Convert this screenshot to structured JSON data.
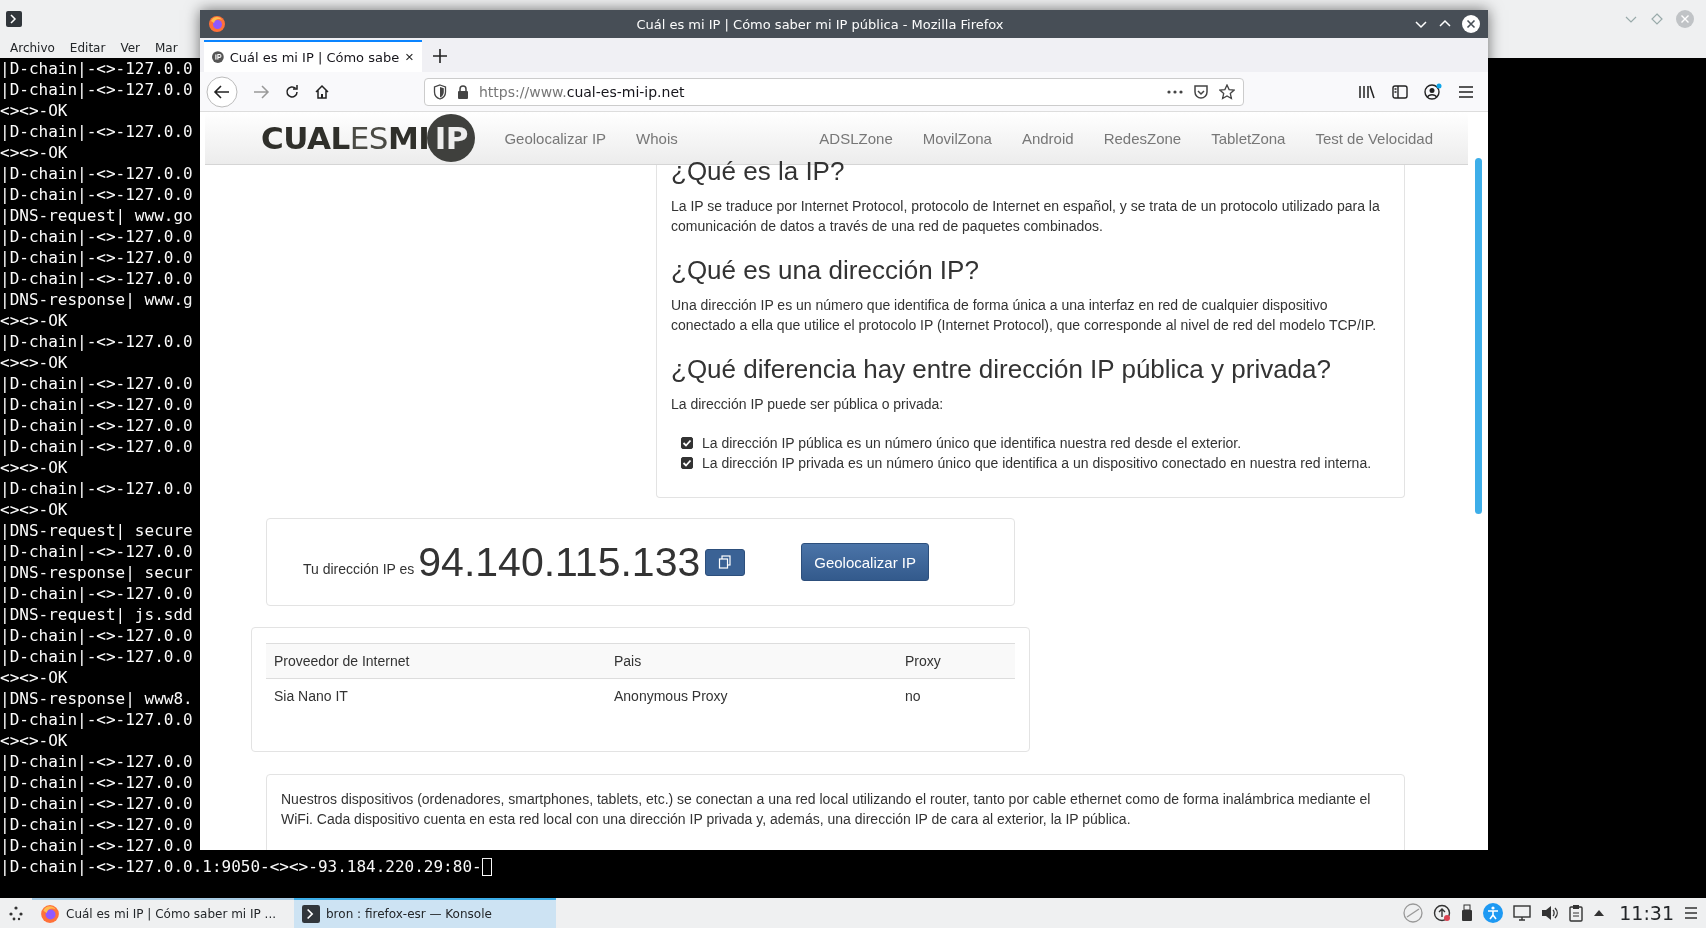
{
  "konsole": {
    "menu": [
      "Archivo",
      "Editar",
      "Ver",
      "Mar"
    ],
    "lines": [
      "|D-chain|-<>-127.0.0",
      "|D-chain|-<>-127.0.0",
      "<><>-OK",
      "|D-chain|-<>-127.0.0",
      "<><>-OK",
      "|D-chain|-<>-127.0.0",
      "|D-chain|-<>-127.0.0",
      "|DNS-request| www.go",
      "|D-chain|-<>-127.0.0",
      "|D-chain|-<>-127.0.0",
      "|D-chain|-<>-127.0.0",
      "|DNS-response| www.g",
      "<><>-OK",
      "|D-chain|-<>-127.0.0",
      "<><>-OK",
      "|D-chain|-<>-127.0.0",
      "|D-chain|-<>-127.0.0",
      "|D-chain|-<>-127.0.0",
      "|D-chain|-<>-127.0.0",
      "<><>-OK",
      "|D-chain|-<>-127.0.0",
      "<><>-OK",
      "|DNS-request| secure",
      "|D-chain|-<>-127.0.0",
      "|DNS-response| secur",
      "|D-chain|-<>-127.0.0",
      "|DNS-request| js.sdd",
      "|D-chain|-<>-127.0.0",
      "|D-chain|-<>-127.0.0",
      "<><>-OK",
      "|DNS-response| www8.",
      "|D-chain|-<>-127.0.0",
      "<><>-OK",
      "|D-chain|-<>-127.0.0",
      "|D-chain|-<>-127.0.0",
      "|D-chain|-<>-127.0.0",
      "|D-chain|-<>-127.0.0",
      "|D-chain|-<>-127.0.0"
    ],
    "prompt_line": "|D-chain|-<>-127.0.0.1:9050-<><>-93.184.220.29:80-"
  },
  "firefox": {
    "title": "Cuál es mi IP | Cómo saber mi IP pública - Mozilla Firefox",
    "tabs": [
      {
        "label": "Cuál es mi IP | Cómo sabe",
        "selected": true
      }
    ],
    "url_prefix": "https://www.",
    "url_domain": "cual-es-mi-ip.net",
    "site": {
      "logo": [
        {
          "text": "CUAL",
          "kind": "bold"
        },
        {
          "text": "ES",
          "kind": "light"
        },
        {
          "text": "MI",
          "kind": "bold"
        },
        {
          "text": "IP",
          "kind": "badge"
        }
      ],
      "nav_left": [
        "Geolocalizar IP",
        "Whois"
      ],
      "nav_right": [
        "ADSLZone",
        "MovilZona",
        "Android",
        "RedesZone",
        "TabletZona",
        "Test de Velocidad"
      ]
    },
    "sections": [
      {
        "heading": "¿Qué es la IP?",
        "paragraph": "La IP se traduce por Internet Protocol, protocolo de Internet en español, y se trata de un protocolo utilizado para la comunicación de datos a través de una red de paquetes combinados."
      },
      {
        "heading": "¿Qué es una dirección IP?",
        "paragraph": "Una dirección IP es un número que identifica de forma única a una interfaz en red de cualquier dispositivo conectado a ella que utilice el protocolo IP (Internet Protocol), que corresponde al nivel de red del modelo TCP/IP."
      },
      {
        "heading": "¿Qué diferencia hay entre dirección IP pública y privada?",
        "paragraph": "La dirección IP puede ser pública o privada:"
      }
    ],
    "checklist": [
      {
        "text": "La dirección IP pública es un número único que identifica nuestra red desde el exterior.",
        "checked": true
      },
      {
        "text": "La dirección IP privada es un número único que identifica a un dispositivo conectado en nuestra red interna.",
        "checked": true
      }
    ],
    "ip_label": "Tu dirección IP es",
    "ip": "94.140.115.133",
    "geo_button": "Geolocalizar IP",
    "table": {
      "columns": [
        "Proveedor de Internet",
        "Pais",
        "Proxy"
      ],
      "rows": [
        [
          "Sia Nano IT",
          "Anonymous Proxy",
          "no"
        ]
      ]
    },
    "footer_text": "Nuestros dispositivos (ordenadores, smartphones, tablets, etc.) se conectan a una red local utilizando el router, tanto por cable ethernet como de forma inalámbrica mediante el WiFi. Cada dispositivo cuenta en esta red local con una dirección IP privada y, además, una dirección IP de cara al exterior, la IP pública."
  },
  "taskbar": {
    "tasks": [
      {
        "label": "Cuál es mi IP | Cómo saber mi IP ...",
        "kind": "firefox",
        "selected": false
      },
      {
        "label": "bron : firefox-esr — Konsole",
        "kind": "konsole",
        "selected": true
      }
    ],
    "clock": "11:31"
  }
}
